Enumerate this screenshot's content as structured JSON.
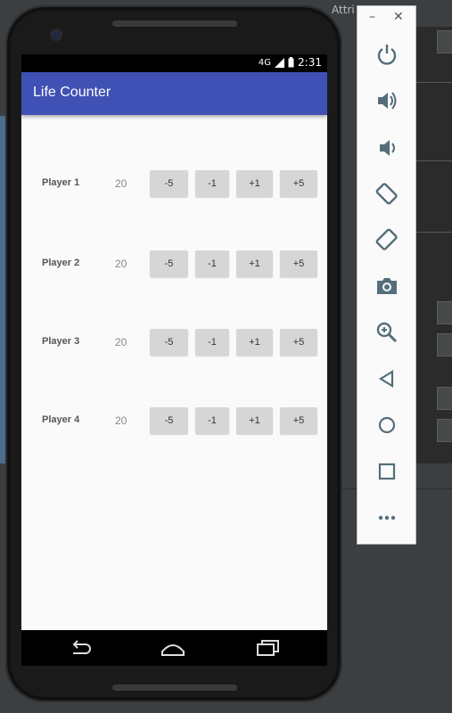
{
  "ide": {
    "attributes_label": "Attri"
  },
  "status_bar": {
    "time": "2:31",
    "network": "4G"
  },
  "app": {
    "title": "Life Counter"
  },
  "players": [
    {
      "name": "Player 1",
      "life": "20",
      "buttons": [
        "-5",
        "-1",
        "+1",
        "+5"
      ]
    },
    {
      "name": "Player 2",
      "life": "20",
      "buttons": [
        "-5",
        "-1",
        "+1",
        "+5"
      ]
    },
    {
      "name": "Player 3",
      "life": "20",
      "buttons": [
        "-5",
        "-1",
        "+1",
        "+5"
      ]
    },
    {
      "name": "Player 4",
      "life": "20",
      "buttons": [
        "-5",
        "-1",
        "+1",
        "+5"
      ]
    }
  ],
  "emulator": {
    "minimize": "–",
    "close": "✕",
    "controls": [
      "power-icon",
      "volume-up-icon",
      "volume-down-icon",
      "rotate-left-icon",
      "rotate-right-icon",
      "camera-icon",
      "zoom-icon",
      "back-icon",
      "home-icon",
      "overview-icon",
      "more-icon"
    ],
    "icon_color": "#546e7a"
  },
  "colors": {
    "app_bar": "#3f51b5",
    "button": "#d6d6d6",
    "background": "#fafafa"
  }
}
